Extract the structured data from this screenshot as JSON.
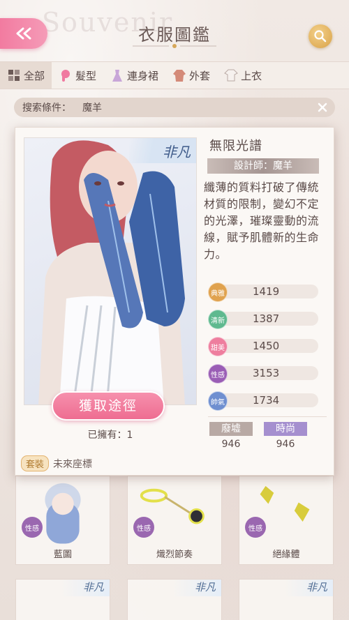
{
  "header": {
    "title": "衣服圖鑑",
    "bg_text": "Souvenir"
  },
  "tabs": [
    {
      "label": "全部",
      "icon": "grid-icon",
      "active": true
    },
    {
      "label": "髮型",
      "icon": "hair-icon",
      "active": false
    },
    {
      "label": "連身裙",
      "icon": "dress-icon",
      "active": false
    },
    {
      "label": "外套",
      "icon": "coat-icon",
      "active": false
    },
    {
      "label": "上衣",
      "icon": "top-icon",
      "active": false
    }
  ],
  "filter": {
    "label": "搜索條件：",
    "value": "魔羊"
  },
  "detail": {
    "rarity": "非凡",
    "name": "無限光譜",
    "designer": "設計師：魔羊",
    "description": "纖薄的質料打破了傳統材質的限制，變幻不定的光澤，璀璨靈動的流線，賦予肌體新的生命力。",
    "get_button": "獲取途徑",
    "owned": "已擁有：1",
    "set_tag": "套裝",
    "set_value": "未來座標",
    "stats": [
      {
        "label": "典雅",
        "value": "1419",
        "color": "#e0a24e"
      },
      {
        "label": "清新",
        "value": "1387",
        "color": "#5fb98f"
      },
      {
        "label": "甜美",
        "value": "1450",
        "color": "#ee7e9e"
      },
      {
        "label": "性感",
        "value": "3153",
        "color": "#9a5db5"
      },
      {
        "label": "帥氣",
        "value": "1734",
        "color": "#6f8fd0"
      }
    ],
    "tags": [
      {
        "label": "廢墟",
        "value": "946",
        "color": "#b8a9a4"
      },
      {
        "label": "時尚",
        "value": "946",
        "color": "#a58fcf"
      }
    ]
  },
  "grid": [
    {
      "name": "藍圖",
      "badge": "性感"
    },
    {
      "name": "熾烈節奏",
      "badge": "性感"
    },
    {
      "name": "絕緣體",
      "badge": "性感"
    }
  ],
  "grid_bottom_rarity": "非凡"
}
